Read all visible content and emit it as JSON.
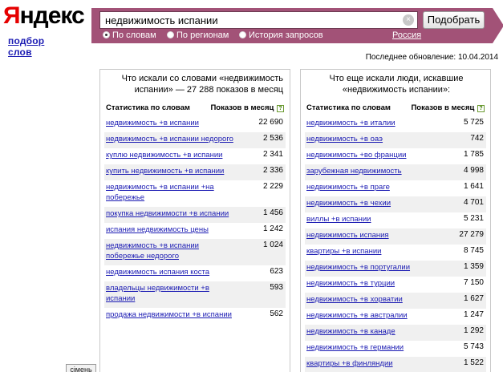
{
  "logo": {
    "first_letter": "Я",
    "rest": "ндекс",
    "subtitle": "подбор слов"
  },
  "search": {
    "value": "недвижимость испании",
    "clear_symbol": "×",
    "button_label": "Подобрать"
  },
  "modes": [
    {
      "label": "По словам",
      "selected": true
    },
    {
      "label": "По регионам",
      "selected": false
    },
    {
      "label": "История запросов",
      "selected": false
    }
  ],
  "region_link": "Россия",
  "updated_text": "Последнее обновление: 10.04.2014",
  "left_panel": {
    "title": "Что искали со словами «недвижимость испании» — 27 288 показов в месяц",
    "col_keyword": "Статистика по словам",
    "col_count": "Показов в месяц",
    "help_icon": "?",
    "rows": [
      {
        "keyword": "недвижимость +в испании",
        "count": "22 690"
      },
      {
        "keyword": "недвижимость +в испании недорого",
        "count": "2 536"
      },
      {
        "keyword": "куплю недвижимость +в испании",
        "count": "2 341"
      },
      {
        "keyword": "купить недвижимость +в испании",
        "count": "2 336"
      },
      {
        "keyword": "недвижимость +в испании +на побережье",
        "count": "2 229"
      },
      {
        "keyword": "покупка недвижимости +в испании",
        "count": "1 456"
      },
      {
        "keyword": "испания недвижимость цены",
        "count": "1 242"
      },
      {
        "keyword": "недвижимость +в испании побережье недорого",
        "count": "1 024"
      },
      {
        "keyword": "недвижимость испания коста",
        "count": "623"
      },
      {
        "keyword": "владельцы недвижимости +в испании",
        "count": "593"
      },
      {
        "keyword": "продажа недвижимости +в испании",
        "count": "562"
      }
    ]
  },
  "right_panel": {
    "title": "Что еще искали люди, искавшие «недвижимость испании»:",
    "col_keyword": "Статистика по словам",
    "col_count": "Показов в месяц",
    "help_icon": "?",
    "rows": [
      {
        "keyword": "недвижимость +в италии",
        "count": "5 725"
      },
      {
        "keyword": "недвижимость +в оаэ",
        "count": "742"
      },
      {
        "keyword": "недвижимость +во франции",
        "count": "1 785"
      },
      {
        "keyword": "зарубежная недвижимость",
        "count": "4 998"
      },
      {
        "keyword": "недвижимость +в праге",
        "count": "1 641"
      },
      {
        "keyword": "недвижимость +в чехии",
        "count": "4 701"
      },
      {
        "keyword": "виллы +в испании",
        "count": "5 231"
      },
      {
        "keyword": "недвижимость испания",
        "count": "27 279"
      },
      {
        "keyword": "квартиры +в испании",
        "count": "8 745"
      },
      {
        "keyword": "недвижимость +в португалии",
        "count": "1 359"
      },
      {
        "keyword": "недвижимость +в турции",
        "count": "7 150"
      },
      {
        "keyword": "недвижимость +в хорватии",
        "count": "1 627"
      },
      {
        "keyword": "недвижимость +в австралии",
        "count": "1 247"
      },
      {
        "keyword": "недвижимость +в канаде",
        "count": "1 292"
      },
      {
        "keyword": "недвижимость +в германии",
        "count": "5 743"
      },
      {
        "keyword": "квартиры +в финляндии",
        "count": "1 522"
      }
    ]
  },
  "tooltip": "сімень"
}
